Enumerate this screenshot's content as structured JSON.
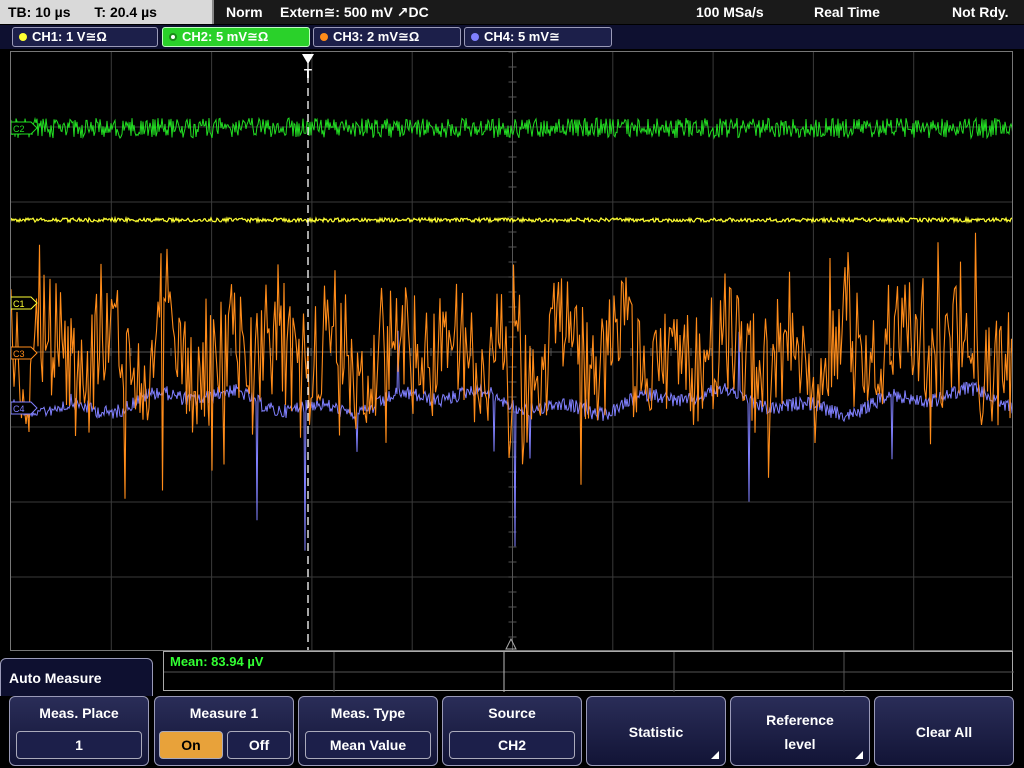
{
  "topbar": {
    "timebase": "TB: 10 µs",
    "trigger_time": "T: 20.4 µs",
    "mode": "Norm",
    "trigger": "Extern≅: 500 mV ↗DC",
    "sample_rate": "100 MSa/s",
    "acq_mode": "Real Time",
    "status": "Not Rdy."
  },
  "channels": [
    {
      "label": "CH1: 1 V≅Ω",
      "color": "#ffff33"
    },
    {
      "label": "CH2: 5 mV≅Ω",
      "color": "#22dd22"
    },
    {
      "label": "CH3: 2 mV≅Ω",
      "color": "#ff8c1a"
    },
    {
      "label": "CH4: 5 mV≅",
      "color": "#8080ff"
    }
  ],
  "markers": {
    "c2": "C2",
    "c1": "C1",
    "c3": "C3",
    "c4": "C4",
    "trigger": "T"
  },
  "measurement": {
    "label": "Mean: 83.94 µV"
  },
  "menu": {
    "title": "Auto Measure",
    "meas_place_label": "Meas. Place",
    "meas_place_value": "1",
    "measure1_label": "Measure 1",
    "on_label": "On",
    "off_label": "Off",
    "meas_type_label": "Meas. Type",
    "meas_type_value": "Mean Value",
    "source_label": "Source",
    "source_value": "CH2",
    "statistic_label": "Statistic",
    "reference_label_1": "Reference",
    "reference_label_2": "level",
    "clear_all_label": "Clear All"
  }
}
